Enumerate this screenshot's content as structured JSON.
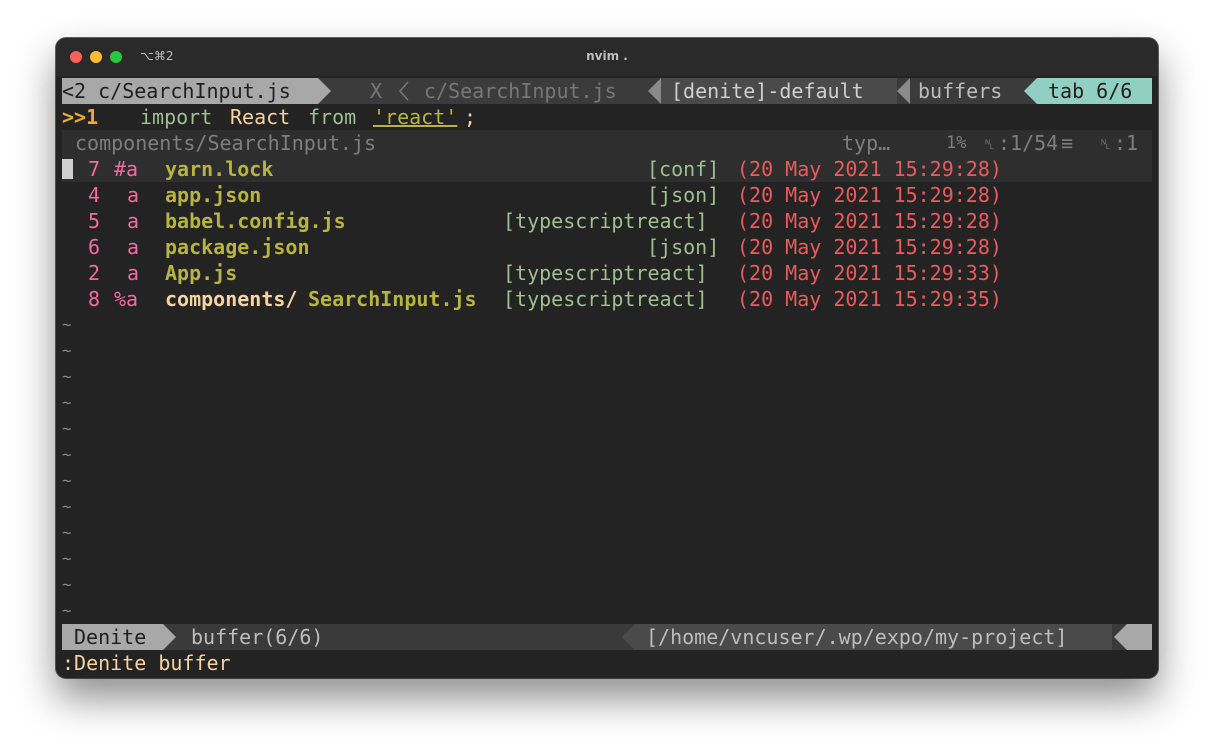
{
  "window": {
    "shortcut": "⌥⌘2",
    "title": "nvim ."
  },
  "tabline": {
    "left_tab": "<2 c/SearchInput.js",
    "close": "X",
    "current_tab": "c/SearchInput.js",
    "denite": "[denite]-default",
    "buffers": "buffers",
    "tab_count": "tab 6/6"
  },
  "code_line": {
    "marker": ">>1",
    "kw_import": "import",
    "ident": "React",
    "kw_from": "from",
    "string": "'react'",
    "semi": ";"
  },
  "file_status": {
    "path": "components/SearchInput.js",
    "filetype": "typ…",
    "percent": "1%",
    "ln_glyph": "␤",
    "position": ":1/54",
    "col_glyph": "␤",
    "col": ":1"
  },
  "buffers": [
    {
      "num": "7",
      "flags": "#a",
      "dir": "",
      "name": "yarn.lock",
      "type": "[conf]",
      "date": "(20 May 2021 15:29:28)"
    },
    {
      "num": "4",
      "flags": "a",
      "dir": "",
      "name": "app.json",
      "type": "[json]",
      "date": "(20 May 2021 15:29:28)"
    },
    {
      "num": "5",
      "flags": "a",
      "dir": "",
      "name": "babel.config.js",
      "type": "[typescriptreact]",
      "date": "(20 May 2021 15:29:28)"
    },
    {
      "num": "6",
      "flags": "a",
      "dir": "",
      "name": "package.json",
      "type": "[json]",
      "date": "(20 May 2021 15:29:28)"
    },
    {
      "num": "2",
      "flags": "a",
      "dir": "",
      "name": "App.js",
      "type": "[typescriptreact]",
      "date": "(20 May 2021 15:29:33)"
    },
    {
      "num": "8",
      "flags": "%a",
      "dir": "components/",
      "name": "SearchInput.js",
      "type": "[typescriptreact]",
      "date": "(20 May 2021 15:29:35)"
    }
  ],
  "tilde": "~",
  "statusline": {
    "mode": "Denite",
    "source": "buffer(6/6)",
    "cwd": "[/home/vncuser/.wp/expo/my-project]"
  },
  "cmdline": ":Denite buffer",
  "colors": {
    "tab_active": "#91cfc3",
    "statusline_bg": "#3a3a3a",
    "buffer_number": "#f36aa0",
    "filename": "#b6b443",
    "filetype": "#9fbf8f",
    "date": "#ea5b5b"
  }
}
